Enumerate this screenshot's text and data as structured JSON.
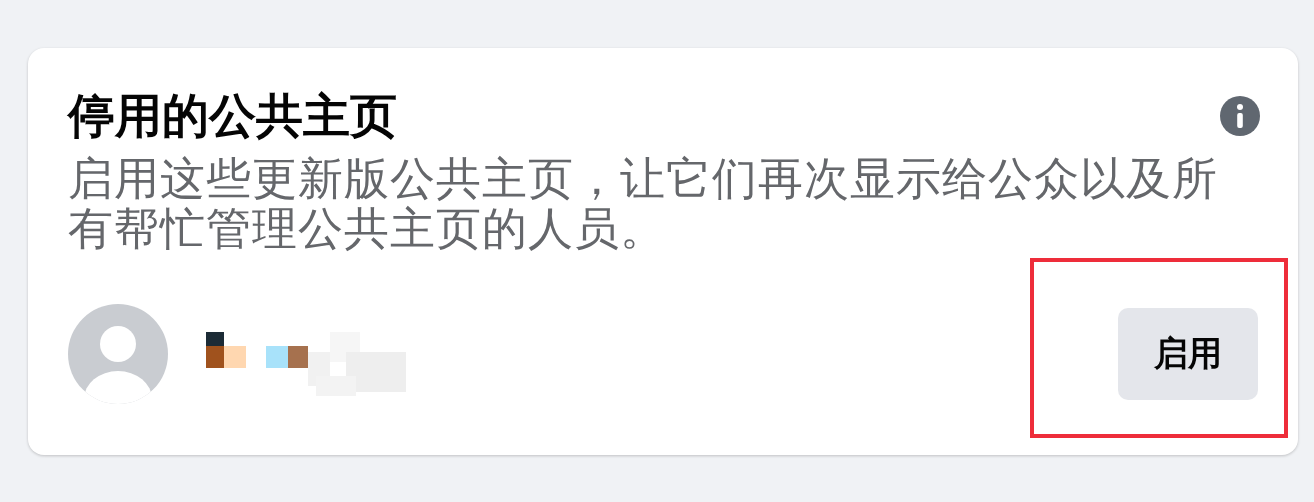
{
  "card": {
    "title": "停用的公共主页",
    "description": "启用这些更新版公共主页，让它们再次显示给公众以及所有帮忙管理公共主页的人员。"
  },
  "page": {
    "enable_button": {
      "label": "启用",
      "highlighted": true
    }
  }
}
